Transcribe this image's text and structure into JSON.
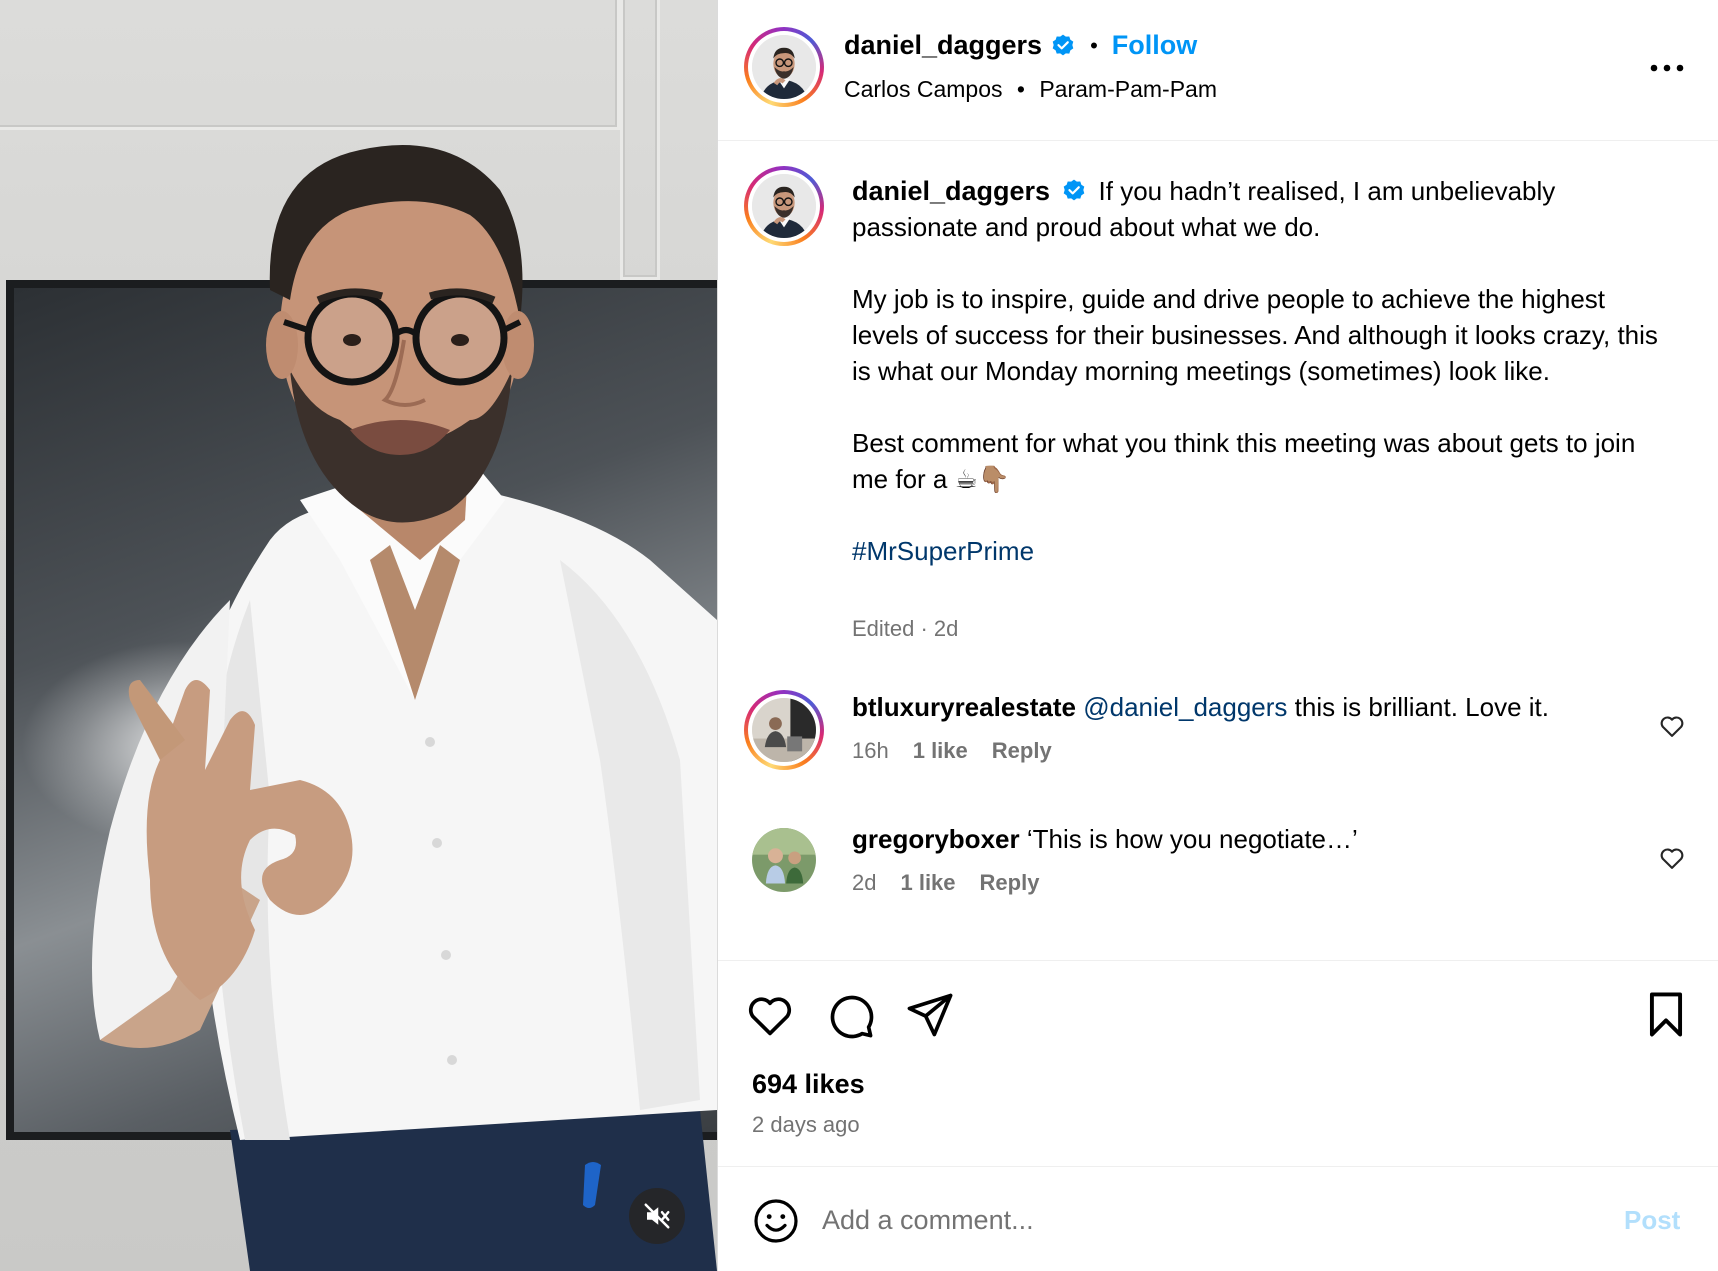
{
  "post": {
    "author": "daniel_daggers",
    "follow_label": "Follow",
    "separator": "•",
    "audio_artist": "Carlos Campos",
    "audio_title": "Param-Pam-Pam"
  },
  "caption": {
    "username": "daniel_daggers",
    "line1": "If you hadn’t realised, I am unbelievably passionate and proud about what we do.",
    "para2": "My job is to inspire, guide and drive people to achieve the highest levels of success for their businesses. And although it looks crazy, this is what our Monday morning meetings (sometimes) look like.",
    "para3": "Best comment for what you think this meeting was about gets to join me for a ☕👇🏽",
    "hashtag": "#MrSuperPrime",
    "meta": "Edited · 2d"
  },
  "comments": [
    {
      "username": "btluxuryrealestate",
      "mention": "@daniel_daggers",
      "text": "this is brilliant. Love it.",
      "time": "16h",
      "likes": "1 like",
      "reply": "Reply"
    },
    {
      "username": "gregoryboxer",
      "mention": "",
      "text": "‘This is how you negotiate…’",
      "time": "2d",
      "likes": "1 like",
      "reply": "Reply"
    }
  ],
  "stats": {
    "likes": "694 likes",
    "time_ago": "2 days ago"
  },
  "add_comment": {
    "placeholder": "Add a comment...",
    "post_label": "Post"
  },
  "colors": {
    "accent": "#0095f6",
    "link": "#00376b",
    "muted": "#737373",
    "post_disabled": "#b2dffc"
  },
  "icons": {
    "verified": "verified-badge-icon",
    "more": "more-options-icon",
    "like": "heart-icon",
    "comment": "comment-bubble-icon",
    "share": "paper-plane-icon",
    "save": "bookmark-icon",
    "emoji": "emoji-icon",
    "mute": "speaker-muted-icon"
  }
}
